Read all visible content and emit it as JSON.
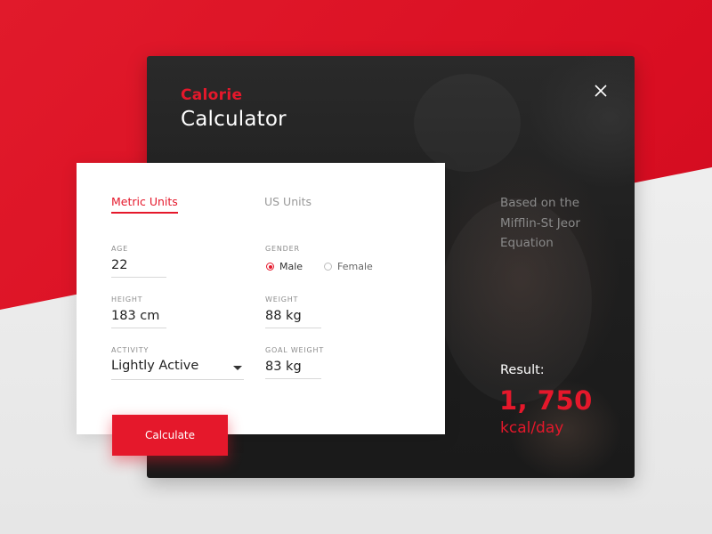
{
  "colors": {
    "accent": "#e5182b",
    "dark_card": "#1f1f1f",
    "background": "#efefef"
  },
  "header": {
    "title_top": "Calorie",
    "title_bottom": "Calculator",
    "close_icon": "close-icon"
  },
  "tabs": [
    {
      "label": "Metric Units",
      "active": true
    },
    {
      "label": "US Units",
      "active": false
    }
  ],
  "form": {
    "age": {
      "label": "AGE",
      "value": "22"
    },
    "gender": {
      "label": "GENDER",
      "options": [
        {
          "label": "Male",
          "selected": true
        },
        {
          "label": "Female",
          "selected": false
        }
      ]
    },
    "height": {
      "label": "HEIGHT",
      "value": "183 cm"
    },
    "weight": {
      "label": "WEIGHT",
      "value": "88 kg"
    },
    "activity": {
      "label": "ACTIVITY",
      "value": "Lightly Active"
    },
    "goal_weight": {
      "label": "GOAL WEIGHT",
      "value": "83 kg"
    },
    "calculate_label": "Calculate"
  },
  "info": {
    "description": "Based on the Mifflin-St Jeor Equation",
    "result_label": "Result:",
    "result_value": "1, 750",
    "result_unit": "kcal/day"
  }
}
